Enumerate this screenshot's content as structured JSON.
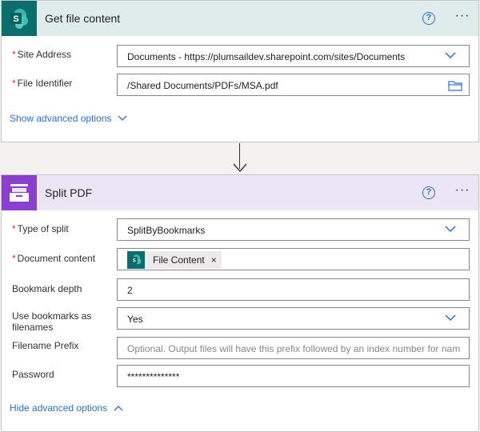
{
  "card1": {
    "title": "Get file content",
    "help_label": "?",
    "more_label": "···",
    "fields": [
      {
        "label": "Site Address",
        "required": true,
        "value": "Documents - https://plumsaildev.sharepoint.com/sites/Documents",
        "control": "dropdown"
      },
      {
        "label": "File Identifier",
        "required": true,
        "value": "/Shared Documents/PDFs/MSA.pdf",
        "control": "file-picker"
      }
    ],
    "advanced_link": "Show advanced options"
  },
  "card2": {
    "title": "Split PDF",
    "help_label": "?",
    "more_label": "···",
    "fields": [
      {
        "label": "Type of split",
        "required": true,
        "value": "SplitByBookmarks",
        "control": "dropdown"
      },
      {
        "label": "Document content",
        "required": true,
        "token_label": "File Content",
        "token_remove": "×",
        "control": "token"
      },
      {
        "label": "Bookmark depth",
        "required": false,
        "value": "2",
        "control": "text"
      },
      {
        "label": "Use bookmarks as filenames",
        "required": false,
        "value": "Yes",
        "control": "dropdown"
      },
      {
        "label": "Filename Prefix",
        "required": false,
        "placeholder": "Optional. Output files will have this prefix followed by an index number for nam",
        "control": "text"
      },
      {
        "label": "Password",
        "required": false,
        "value": "**************",
        "control": "password"
      }
    ],
    "advanced_link": "Hide advanced options"
  },
  "required_marker": "*",
  "colors": {
    "sharepoint_teal": "#0b6d6d",
    "plumsail_purple": "#8b3fcf",
    "card1_header_bg": "#e0ecec",
    "card2_header_bg": "#ebe5f6",
    "link_blue": "#2f6fd0",
    "required_red": "#d13438"
  },
  "icons": {
    "card1_app": "sharepoint-icon",
    "card2_app": "plumsail-documents-icon",
    "help": "help-circle-icon",
    "more": "more-options-icon",
    "dropdown": "chevron-down-icon",
    "file": "folder-icon",
    "show_adv": "chevron-down-icon",
    "hide_adv": "chevron-up-icon",
    "connector": "arrow-down-icon"
  }
}
